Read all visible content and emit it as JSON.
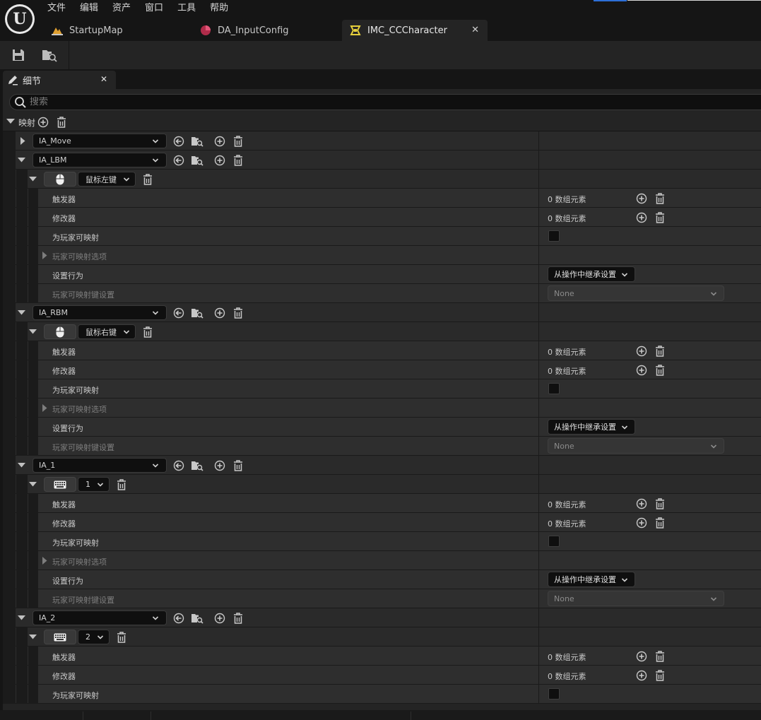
{
  "menu": [
    "文件",
    "编辑",
    "资产",
    "窗口",
    "工具",
    "帮助"
  ],
  "logo_text": "U",
  "tabs": [
    {
      "label": "StartupMap",
      "icon": "level-icon"
    },
    {
      "label": "DA_InputConfig",
      "icon": "data-asset-icon"
    },
    {
      "label": "IMC_CCCharacter",
      "icon": "input-mapping-icon",
      "active": true
    }
  ],
  "panel": {
    "title": "细节"
  },
  "search": {
    "placeholder": "搜索"
  },
  "mapping": {
    "label": "映射"
  },
  "labels": {
    "triggers": "触发器",
    "modifiers": "修改器",
    "player_mappable": "为玩家可映射",
    "player_mappable_options": "玩家可映射选项",
    "setting_behavior": "设置行为",
    "player_mappable_key_settings": "玩家可映射键设置",
    "array_elements": "0 数组元素",
    "inherit_setting": "从操作中继承设置",
    "none": "None"
  },
  "actions": [
    {
      "name": "IA_Move",
      "expanded": false
    },
    {
      "name": "IA_LBM",
      "expanded": true,
      "key": "鼠标左键",
      "key_icon": "mouse-icon"
    },
    {
      "name": "IA_RBM",
      "expanded": true,
      "key": "鼠标右键",
      "key_icon": "mouse-icon"
    },
    {
      "name": "IA_1",
      "expanded": true,
      "key": "1",
      "key_icon": "keyboard-icon"
    },
    {
      "name": "IA_2",
      "expanded": true,
      "key": "2",
      "key_icon": "keyboard-icon"
    }
  ]
}
